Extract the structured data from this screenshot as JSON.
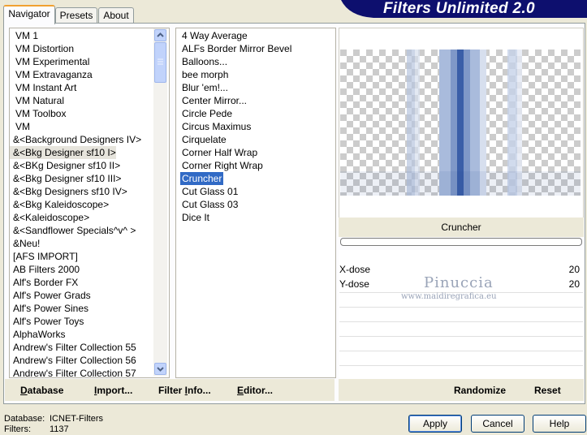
{
  "tabs": [
    {
      "label": "Navigator",
      "active": true
    },
    {
      "label": "Presets",
      "active": false
    },
    {
      "label": "About",
      "active": false
    }
  ],
  "banner": {
    "title": "Filters Unlimited 2.0",
    "color": "#0d0f6e"
  },
  "categories": [
    "VM 1",
    "VM Distortion",
    "VM Experimental",
    "VM Extravaganza",
    "VM Instant Art",
    "VM Natural",
    "VM Toolbox",
    "VM",
    "&<Background Designers IV>",
    "&<Bkg Designer sf10 I>",
    "&<BKg Designer sf10 II>",
    "&<Bkg Designer sf10 III>",
    "&<Bkg Designers sf10 IV>",
    "&<Bkg Kaleidoscope>",
    "&<Kaleidoscope>",
    "&<Sandflower Specials^v^ >",
    "&Neu!",
    "[AFS IMPORT]",
    "AB Filters 2000",
    "Alf's Border FX",
    "Alf's Power Grads",
    "Alf's Power Sines",
    "Alf's Power Toys",
    "AlphaWorks",
    "Andrew's Filter Collection 55",
    "Andrew's Filter Collection 56",
    "Andrew's Filter Collection 57"
  ],
  "categories_highlighted_index": 9,
  "filters": [
    "4 Way Average",
    "ALFs Border Mirror Bevel",
    "Balloons...",
    "bee morph",
    "Blur 'em!...",
    "Center Mirror...",
    "Circle Pede",
    "Circus Maximus",
    "Cirquelate",
    "Corner Half Wrap",
    "Corner Right Wrap",
    "Cruncher",
    "Cut Glass  01",
    "Cut Glass  03",
    "Dice It"
  ],
  "filters_selected_index": 11,
  "preview": {
    "filter_name": "Cruncher",
    "progress": 0
  },
  "params": [
    {
      "label": "X-dose",
      "value": "20"
    },
    {
      "label": "Y-dose",
      "value": "20"
    }
  ],
  "watermark": {
    "line1": "Pinuccia",
    "line2": "www.maidiregrafica.eu"
  },
  "toolbar": {
    "database": {
      "pre": "",
      "u": "D",
      "post": "atabase"
    },
    "import": {
      "pre": "",
      "u": "I",
      "post": "mport..."
    },
    "filter_info": {
      "pre": "Filter ",
      "u": "I",
      "post": "nfo..."
    },
    "editor": {
      "pre": "",
      "u": "E",
      "post": "ditor..."
    },
    "randomize": "Randomize",
    "reset": "Reset"
  },
  "status": {
    "database_label": "Database:",
    "database_value": "ICNET-Filters",
    "filters_label": "Filters:",
    "filters_value": "1137"
  },
  "buttons": {
    "apply": "Apply",
    "cancel": "Cancel",
    "help": "Help"
  },
  "colors": {
    "selection": "#316ac5",
    "banner": "#0d0f6e",
    "accent_tab": "#f1a131"
  }
}
